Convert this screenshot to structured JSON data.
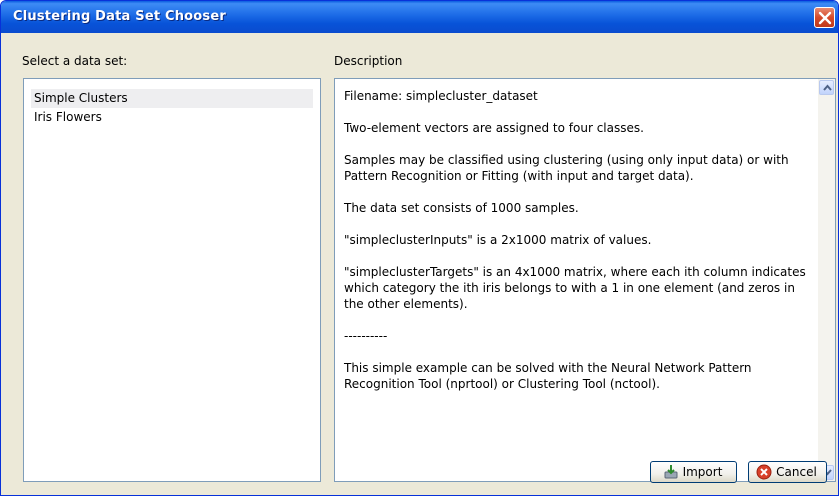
{
  "window": {
    "title": "Clustering Data Set Chooser"
  },
  "left": {
    "label": "Select a data set:",
    "items": [
      {
        "label": "Simple Clusters",
        "selected": true
      },
      {
        "label": "Iris Flowers",
        "selected": false
      }
    ]
  },
  "right": {
    "label": "Description",
    "paragraphs": [
      "Filename: simplecluster_dataset",
      "Two-element vectors are assigned to four classes.",
      "Samples may be classified using clustering (using only input data) or with Pattern Recognition or Fitting (with input and target data).",
      "The data set consists of 1000 samples.",
      "\"simpleclusterInputs\" is a 2x1000 matrix of values.",
      "\"simpleclusterTargets\" is an 4x1000 matrix, where each ith column indicates which category the ith iris belongs to with a 1 in one element (and zeros in the other elements).",
      "----------",
      "This simple example can be solved with the Neural Network Pattern Recognition Tool (nprtool) or Clustering Tool (nctool)."
    ]
  },
  "buttons": {
    "import": "Import",
    "cancel": "Cancel"
  },
  "icons": {
    "close": "close-icon",
    "import": "import-icon",
    "cancel": "cancel-icon",
    "scroll_up": "arrow-up-icon",
    "scroll_down": "arrow-down-icon"
  },
  "colors": {
    "titlebar": "#0a5ce0",
    "close": "#d54a2a",
    "window_bg": "#ece9d8",
    "selection": "#eeeef0"
  }
}
